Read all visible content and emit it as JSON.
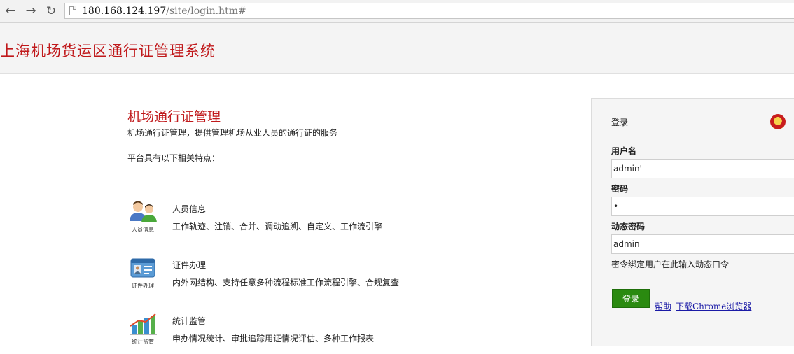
{
  "browser": {
    "url_host": "180.168.124.197",
    "url_path": "/site/login.htm#"
  },
  "header": {
    "title": "上海机场货运区通行证管理系统"
  },
  "intro": {
    "title": "机场通行证管理",
    "description": "机场通行证管理，提供管理机场从业人员的通行证的服务",
    "features_heading": "平台具有以下相关特点："
  },
  "features": [
    {
      "icon": "people-icon",
      "icon_caption": "人员信息",
      "title": "人员信息",
      "description": "工作轨迹、注销、合并、调动追溯、自定义、工作流引擎"
    },
    {
      "icon": "id-card-icon",
      "icon_caption": "证件办理",
      "title": "证件办理",
      "description": "内外网结构、支持任意多种流程标准工作流程引擎、合规复查"
    },
    {
      "icon": "bar-chart-icon",
      "icon_caption": "统计监管",
      "title": "统计监管",
      "description": "申办情况统计、审批追踪用证情况评估、多种工作报表"
    }
  ],
  "login": {
    "title": "登录",
    "emblem_icon": "national-emblem-icon",
    "username_label": "用户名",
    "username_value": "admin'",
    "password_label": "密码",
    "password_value": "•",
    "otp_label": "动态密码",
    "otp_value": "admin",
    "otp_hint": "密令绑定用户在此输入动态口令",
    "submit_label": "登录",
    "help_link": "帮助",
    "download_link": "下载Chrome浏览器"
  },
  "colors": {
    "brand_red": "#c0191b",
    "button_green": "#2a8a10",
    "link_blue": "#1a1aa6"
  }
}
